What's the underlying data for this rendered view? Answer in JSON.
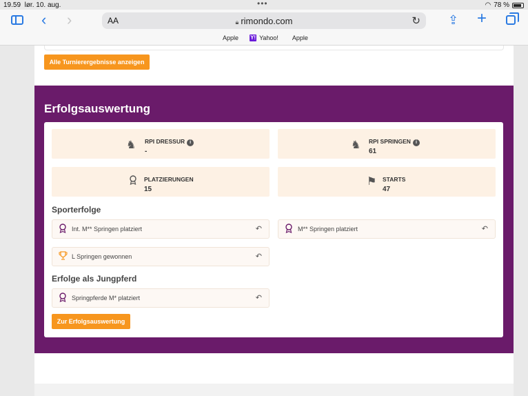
{
  "status": {
    "time": "19.59",
    "date": "lør. 10. aug.",
    "battery": "78 %"
  },
  "browser": {
    "aa": "AA",
    "url": "rimondo.com",
    "favorites": [
      {
        "label": "Apple",
        "icon": "apple-icon"
      },
      {
        "label": "Yahoo!",
        "icon": "yahoo-icon"
      },
      {
        "label": "Apple",
        "icon": "apple-icon"
      }
    ]
  },
  "page": {
    "results_button": "Alle Turnierergebnisse anzeigen",
    "section_title": "Erfolgsauswertung",
    "stats": [
      {
        "label": "RPI DRESSUR",
        "value": "-",
        "icon": "dressage-horse-icon",
        "info": true
      },
      {
        "label": "RPI SPRINGEN",
        "value": "61",
        "icon": "jumping-horse-icon",
        "info": true
      },
      {
        "label": "PLATZIERUNGEN",
        "value": "15",
        "icon": "rosette-icon",
        "info": false
      },
      {
        "label": "STARTS",
        "value": "47",
        "icon": "flag-icon",
        "info": false
      }
    ],
    "sport_title": "Sporterfolge",
    "sport_items": [
      {
        "text": "Int. M** Springen platziert",
        "icon": "rosette-icon"
      },
      {
        "text": "M** Springen platziert",
        "icon": "rosette-icon"
      },
      {
        "text": "L Springen gewonnen",
        "icon": "trophy-icon"
      }
    ],
    "young_title": "Erfolge als Jungpferd",
    "young_items": [
      {
        "text": "Springpferde M* platziert",
        "icon": "rosette-icon"
      }
    ],
    "success_button": "Zur Erfolgsauswertung"
  },
  "colors": {
    "accent": "#f7961e",
    "purple": "#6a1b6a",
    "tile": "#fdf1e4"
  }
}
